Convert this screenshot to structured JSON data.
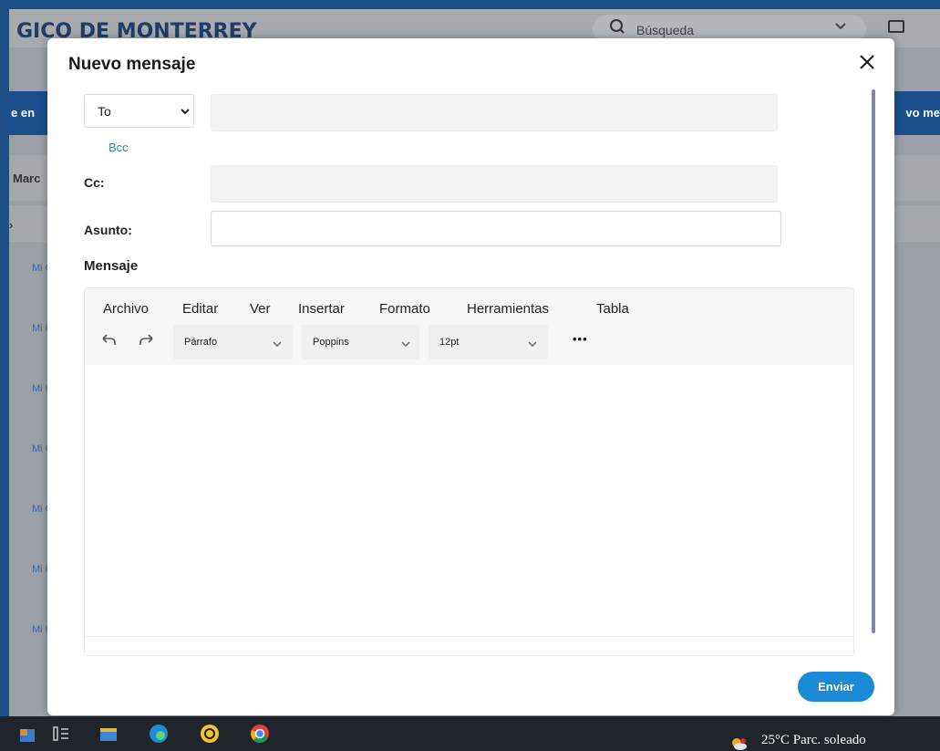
{
  "background": {
    "app_title": "GICO DE MONTERREY",
    "search_placeholder": "Búsqueda",
    "bar_left": "e en",
    "bar_right": "vo me",
    "row1_label": "Marc",
    "list_items": [
      "Mi Cu (A",
      "Mi Cu (A",
      "Mi Cu (A",
      "Mi Cu (A",
      "Mi Cu (A",
      "Mi Cu (A",
      "Mi Cu (A"
    ]
  },
  "modal": {
    "title": "Nuevo mensaje",
    "to_select": "To",
    "bcc_link": "Bcc",
    "cc_label": "Cc:",
    "subject_label": "Asunto:",
    "message_label": "Mensaje",
    "send_label": "Enviar"
  },
  "editor": {
    "menus": [
      "Archivo",
      "Editar",
      "Ver",
      "Insertar",
      "Formato",
      "Herramientas",
      "Tabla"
    ],
    "block_format": "Párrafo",
    "font_family": "Poppins",
    "font_size": "12pt",
    "more": "•••"
  },
  "taskbar": {
    "weather": "25°C  Parc. soleado"
  },
  "colors": {
    "accent": "#1a8ad6",
    "bg_bar": "#1a4f8c"
  }
}
